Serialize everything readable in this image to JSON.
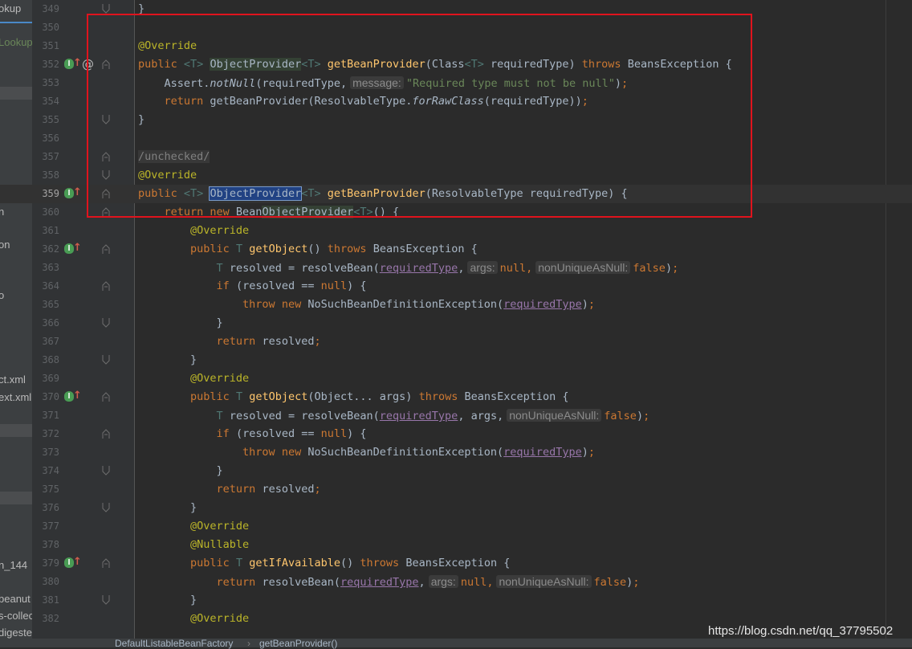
{
  "sidebar": {
    "items": [
      "okup",
      "Lookup",
      "n",
      "on",
      "o",
      "ct.xml",
      "ext.xml",
      "n_144",
      "beanut",
      "s-collec",
      "digeste"
    ]
  },
  "editor": {
    "lines": [
      {
        "no": "349"
      },
      {
        "no": "350"
      },
      {
        "no": "351"
      },
      {
        "no": "352"
      },
      {
        "no": "353"
      },
      {
        "no": "354"
      },
      {
        "no": "355"
      },
      {
        "no": "356"
      },
      {
        "no": "357"
      },
      {
        "no": "358"
      },
      {
        "no": "359"
      },
      {
        "no": "360"
      },
      {
        "no": "361"
      },
      {
        "no": "362"
      },
      {
        "no": "363"
      },
      {
        "no": "364"
      },
      {
        "no": "365"
      },
      {
        "no": "366"
      },
      {
        "no": "367"
      },
      {
        "no": "368"
      },
      {
        "no": "369"
      },
      {
        "no": "370"
      },
      {
        "no": "371"
      },
      {
        "no": "372"
      },
      {
        "no": "373"
      },
      {
        "no": "374"
      },
      {
        "no": "375"
      },
      {
        "no": "376"
      },
      {
        "no": "377"
      },
      {
        "no": "378"
      },
      {
        "no": "379"
      },
      {
        "no": "380"
      },
      {
        "no": "381"
      },
      {
        "no": "382"
      }
    ],
    "hints": {
      "message": "message:",
      "args": "args:",
      "nonUniqueAsNull": "nonUniqueAsNull:"
    },
    "comment_unchecked": "/unchecked/"
  },
  "breadcrumb": [
    "DefaultListableBeanFactory",
    "getBeanProvider()"
  ],
  "watermark": "https://blog.csdn.net/qq_37795502",
  "colors": {
    "keyword": "#cc7832",
    "annotation": "#bbb529",
    "method": "#ffc66d",
    "string": "#6a8759",
    "field": "#9876aa",
    "highlight_box": "#e0131d"
  }
}
